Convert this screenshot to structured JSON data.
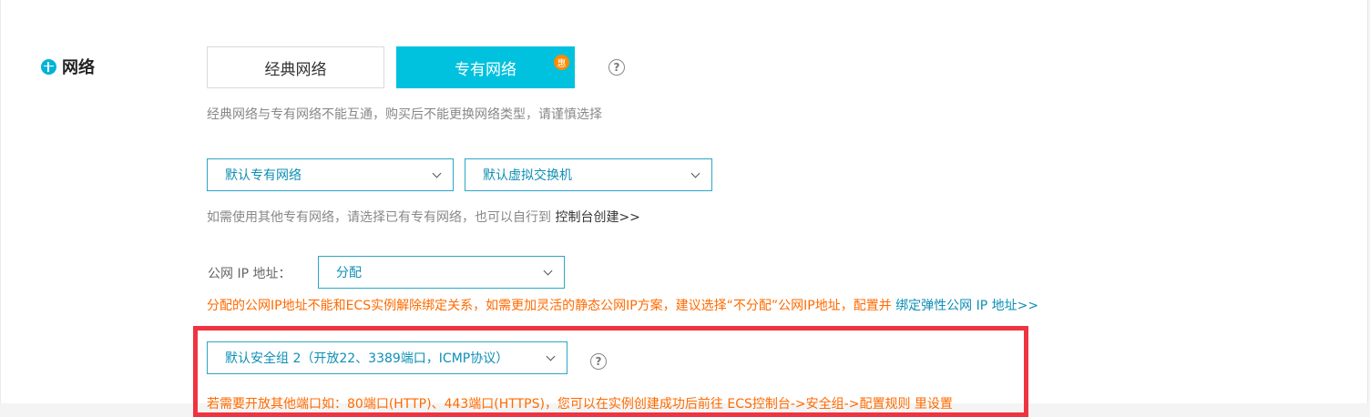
{
  "section": {
    "title": "网络",
    "icon": "globe-icon"
  },
  "network_type": {
    "classic_label": "经典网络",
    "vpc_label": "专有网络",
    "promo_badge": "惠",
    "help": "?",
    "hint": "经典网络与专有网络不能互通，购买后不能更换网络类型，请谨慎选择"
  },
  "vpc": {
    "vpc_select": "默认专有网络",
    "vswitch_select": "默认虚拟交换机",
    "hint": "如需使用其他专有网络，请选择已有专有网络，也可以自行到",
    "hint_link": "控制台创建>>"
  },
  "public_ip": {
    "label": "公网 IP 地址：",
    "value": "分配",
    "warning": "分配的公网IP地址不能和ECS实例解除绑定关系，如需更加灵活的静态公网IP方案，建议选择“不分配”公网IP地址，配置并",
    "warning_link": "绑定弹性公网 IP 地址>>"
  },
  "security_group": {
    "value": "默认安全组 2（开放22、3389端口，ICMP协议）",
    "help": "?",
    "notice": "若需要开放其他端口如：80端口(HTTP)、443端口(HTTPS)，您可以在实例创建成功后前往 ECS控制台->安全组->配置规则 里设置"
  },
  "colors": {
    "accent": "#00c1de",
    "warning": "#ff6a00",
    "highlight": "#ef3340"
  }
}
